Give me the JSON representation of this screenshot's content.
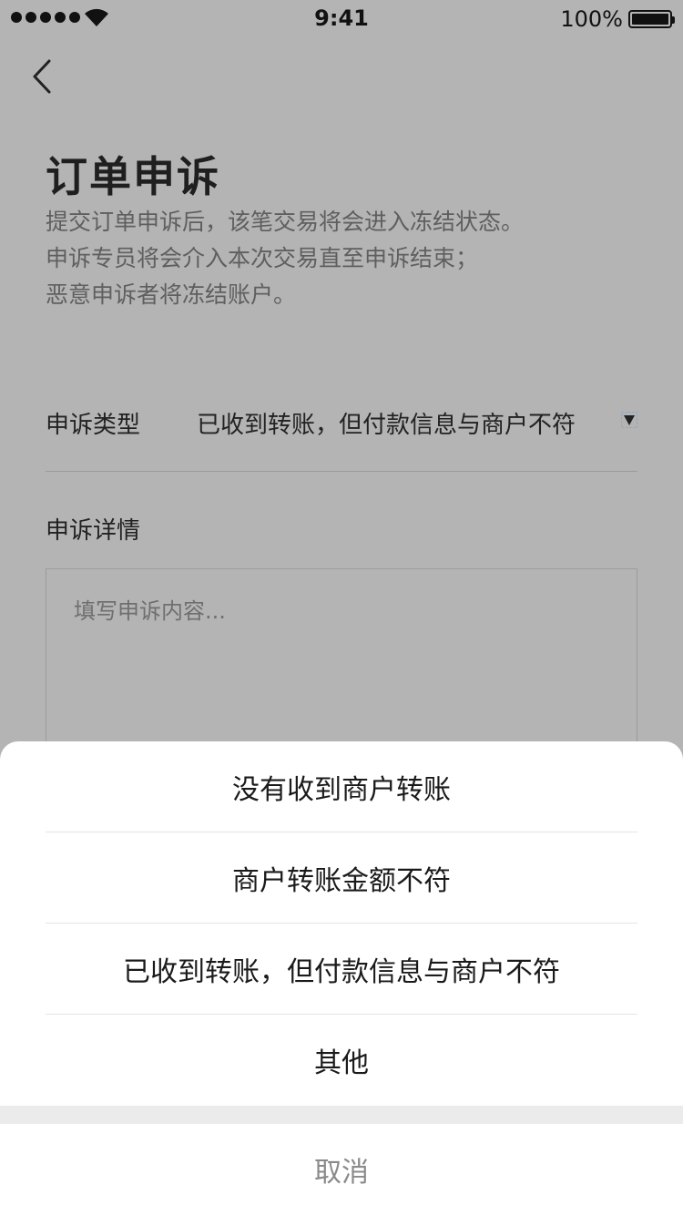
{
  "status_bar": {
    "time": "9:41",
    "battery": "100%"
  },
  "header": {
    "title": "订单申诉",
    "description": [
      "提交订单申诉后，该笔交易将会进入冻结状态。",
      "申诉专员将会介入本次交易直至申诉结束；",
      "恶意申诉者将冻结账户。"
    ]
  },
  "form": {
    "type_label": "申诉类型",
    "type_value": "已收到转账，但付款信息与商户不符",
    "detail_label": "申诉详情",
    "detail_placeholder": "填写申诉内容..."
  },
  "action_sheet": {
    "options": [
      "没有收到商户转账",
      "商户转账金额不符",
      "已收到转账，但付款信息与商户不符",
      "其他"
    ],
    "cancel": "取消"
  }
}
